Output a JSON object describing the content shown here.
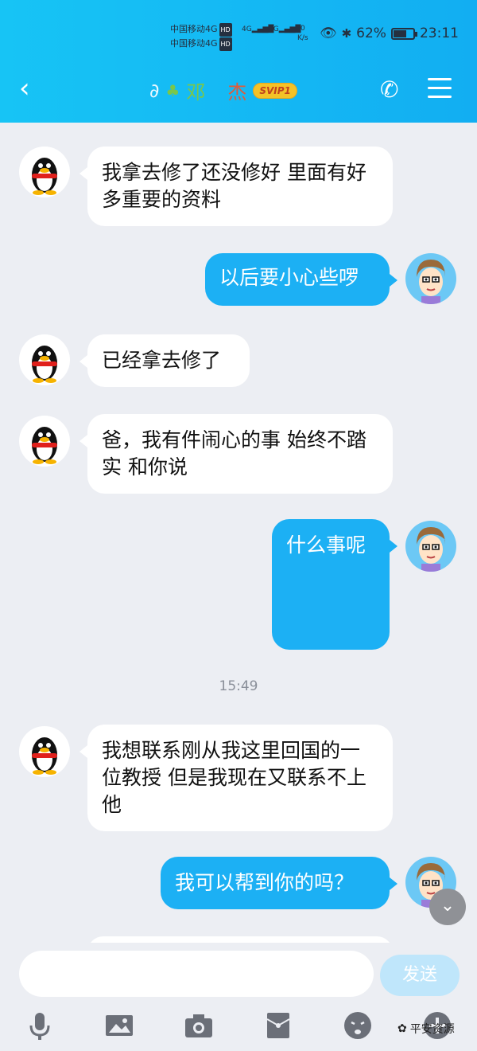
{
  "status_bar": {
    "carrier_line_1": "中国移动4G",
    "carrier_line_2": "中国移动4G",
    "hd_badge": "HD",
    "signal_1": "4G",
    "signal_2": "4G",
    "speed_value": "0",
    "speed_unit": "K/s",
    "battery": "62%",
    "battery_level": 0.62,
    "time": "23:11"
  },
  "header": {
    "name_part_1": "邓",
    "name_part_2": "杰",
    "badge": "SVIP1"
  },
  "messages": [
    {
      "side": "in",
      "text": "我拿去修了还没修好 里面有好多重要的资料"
    },
    {
      "side": "out",
      "text": "以后要小心些啰"
    },
    {
      "side": "in",
      "text": "已经拿去修了"
    },
    {
      "side": "in",
      "text": "爸，我有件闹心的事 始终不踏实 和你说"
    },
    {
      "side": "out",
      "text": "什么事呢"
    },
    {
      "side": "in",
      "text": "我想联系刚从我这里回国的一位教授 但是我现在又联系不上他"
    },
    {
      "side": "out",
      "text": "我可以帮到你的吗？"
    }
  ],
  "timestamp": "15:49",
  "input": {
    "placeholder": "",
    "send_label": "发送"
  },
  "watermark": "平安资源",
  "colors": {
    "header": "#17c4f5",
    "out_bubble": "#1cb0f4",
    "send_disabled": "#bfe6fb"
  }
}
